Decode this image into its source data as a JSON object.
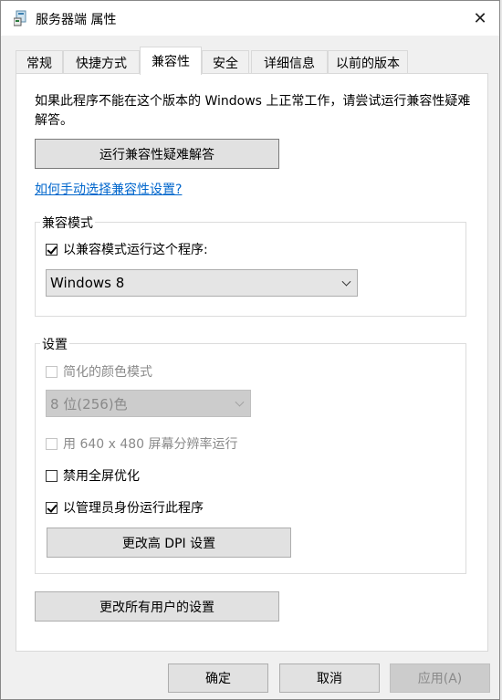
{
  "window": {
    "title": "服务器端 属性",
    "icon": "app-icon",
    "close_glyph": "✕"
  },
  "tabs": [
    {
      "label": "常规",
      "active": false
    },
    {
      "label": "快捷方式",
      "active": false
    },
    {
      "label": "兼容性",
      "active": true
    },
    {
      "label": "安全",
      "active": false
    },
    {
      "label": "详细信息",
      "active": false
    },
    {
      "label": "以前的版本",
      "active": false
    }
  ],
  "panel": {
    "intro": "如果此程序不能在这个版本的 Windows 上正常工作，请尝试运行兼容性疑难解答。",
    "troubleshoot_button": "运行兼容性疑难解答",
    "manual_link": "如何手动选择兼容性设置?"
  },
  "compat_mode": {
    "group_label": "兼容模式",
    "checkbox_label": "以兼容模式运行这个程序:",
    "checked": true,
    "selected_os": "Windows 8"
  },
  "settings": {
    "group_label": "设置",
    "reduced_color": {
      "label": "简化的颜色模式",
      "checked": false,
      "disabled": true
    },
    "color_select": {
      "value": "8 位(256)色",
      "disabled": true
    },
    "resolution_640": {
      "label": "用 640 x 480 屏幕分辨率运行",
      "checked": false,
      "disabled": true
    },
    "disable_fullscreen": {
      "label": "禁用全屏优化",
      "checked": false
    },
    "run_as_admin": {
      "label": "以管理员身份运行此程序",
      "checked": true
    },
    "dpi_button": "更改高 DPI 设置"
  },
  "all_users_button": "更改所有用户的设置",
  "footer": {
    "ok": "确定",
    "cancel": "取消",
    "apply": "应用(A)"
  }
}
